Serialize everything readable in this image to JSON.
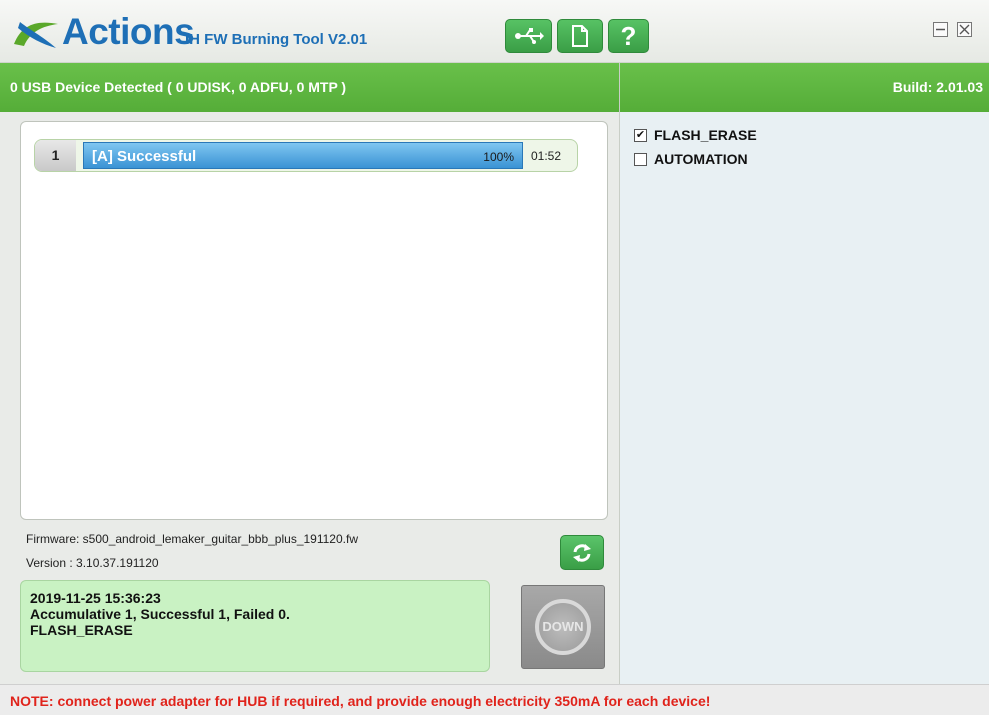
{
  "header": {
    "brand": "Actions",
    "subtitle": "IH FW Burning Tool V2.01",
    "help_label": "?"
  },
  "status": {
    "usb_detected": "0 USB Device Detected ( 0 UDISK, 0 ADFU, 0 MTP )",
    "build": "Build: 2.01.03"
  },
  "devices": [
    {
      "index": "1",
      "status": "[A] Successful",
      "percent_label": "100%",
      "progress": 1.0,
      "time": "01:52"
    }
  ],
  "firmware": {
    "file_line": "Firmware: s500_android_lemaker_guitar_bbb_plus_191120.fw",
    "version_line": "Version : 3.10.37.191120"
  },
  "log": {
    "lines": [
      "2019-11-25 15:36:23",
      "Accumulative 1, Successful 1, Failed 0.",
      "FLASH_ERASE"
    ]
  },
  "down_button": {
    "label": "DOWN"
  },
  "options": [
    {
      "label": "FLASH_ERASE",
      "checked": true
    },
    {
      "label": "AUTOMATION",
      "checked": false
    }
  ],
  "note": "NOTE: connect power adapter for HUB if required, and provide enough electricity 350mA for each device!",
  "colors": {
    "brand_blue": "#1e6fb6",
    "status_green": "#5cb73f",
    "progress_blue": "#3a93d4",
    "log_green": "#c9f2c3",
    "note_red": "#e0231b"
  }
}
